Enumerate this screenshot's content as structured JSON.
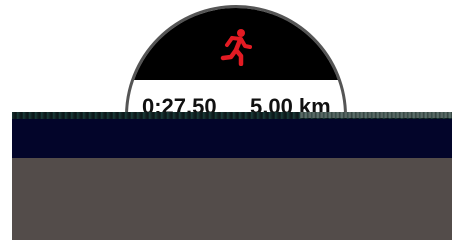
{
  "workout": {
    "activity_icon": "running-person-icon",
    "elapsed_time": "0:27.50",
    "distance_value": "5.00",
    "distance_unit": "km"
  },
  "colors": {
    "accent": "#e31b23",
    "watch_bezel": "#555555",
    "header_bg": "#000000",
    "overlay_dark": "#03052a",
    "overlay_gray": "#534c4a"
  }
}
